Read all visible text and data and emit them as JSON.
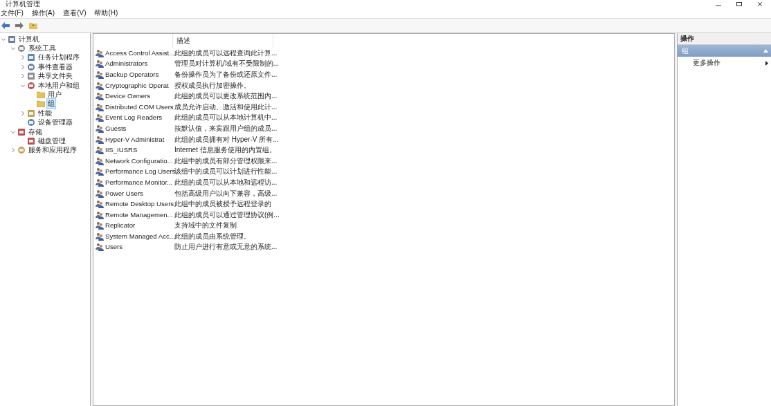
{
  "window": {
    "title": "计算机管理"
  },
  "menu": [
    "文件(F)",
    "操作(A)",
    "查看(V)",
    "帮助(H)"
  ],
  "tree": [
    {
      "label": "计算机",
      "selected": false,
      "expanded": true,
      "children": [
        {
          "label": "系统工具",
          "selected": false,
          "expanded": true,
          "children": [
            {
              "label": "任务计划程序",
              "selected": false,
              "expanded": false
            },
            {
              "label": "事件查看器",
              "selected": false,
              "expanded": false
            },
            {
              "label": "共享文件夹",
              "selected": false,
              "expanded": false
            },
            {
              "label": "本地用户和组",
              "selected": false,
              "expanded": true,
              "children": [
                {
                  "label": "用户",
                  "selected": false
                },
                {
                  "label": "组",
                  "selected": true
                }
              ]
            },
            {
              "label": "性能",
              "selected": false,
              "expanded": false
            },
            {
              "label": "设备管理器",
              "selected": false
            }
          ]
        },
        {
          "label": "存储",
          "selected": false,
          "expanded": true,
          "children": [
            {
              "label": "磁盘管理",
              "selected": false
            }
          ]
        },
        {
          "label": "服务和应用程序",
          "selected": false,
          "expanded": false
        }
      ]
    }
  ],
  "table": {
    "columns": [
      "描述"
    ],
    "rows": [
      {
        "name": "Access Control Assist...",
        "description": "此组的成员可以远程查询此计算..."
      },
      {
        "name": "Administrators",
        "description": "管理员对计算机/域有不受限制的..."
      },
      {
        "name": "Backup Operators",
        "description": "备份操作员为了备份或还原文件..."
      },
      {
        "name": "Cryptographic Operat",
        "description": "授权成员执行加密操作。"
      },
      {
        "name": "Device Owners",
        "description": "此组的成员可以更改系统范围内..."
      },
      {
        "name": "Distributed COM Users",
        "description": "成员允许启动、激活和使用此计..."
      },
      {
        "name": "Event Log Readers",
        "description": "此组的成员可以从本地计算机中..."
      },
      {
        "name": "Guests",
        "description": "按默认值，来宾跟用户组的成员..."
      },
      {
        "name": "Hyper-V Administrat",
        "description": "此组的成员拥有对 Hyper-V 所有..."
      },
      {
        "name": "IIS_IUSRS",
        "description": "Internet 信息服务使用的内置组。"
      },
      {
        "name": "Network Configuratio...",
        "description": "此组中的成员有部分管理权限来..."
      },
      {
        "name": "Performance Log Users",
        "description": "该组中的成员可以计划进行性能..."
      },
      {
        "name": "Performance Monitor...",
        "description": "此组的成员可以从本地和远程访..."
      },
      {
        "name": "Power Users",
        "description": "包括高级用户以向下兼容，高级..."
      },
      {
        "name": "Remote Desktop Users",
        "description": "此组中的成员被授予远程登录的"
      },
      {
        "name": "Remote Managemen...",
        "description": "此组的成员可以通过管理协议(例..."
      },
      {
        "name": "Replicator",
        "description": "支持域中的文件复制"
      },
      {
        "name": "System Managed Acc...",
        "description": "此组的成员由系统管理。"
      },
      {
        "name": "Users",
        "description": "防止用户进行有意或无意的系统..."
      }
    ]
  },
  "actions": {
    "title": "操作",
    "section": "组",
    "items": [
      "更多操作"
    ]
  }
}
